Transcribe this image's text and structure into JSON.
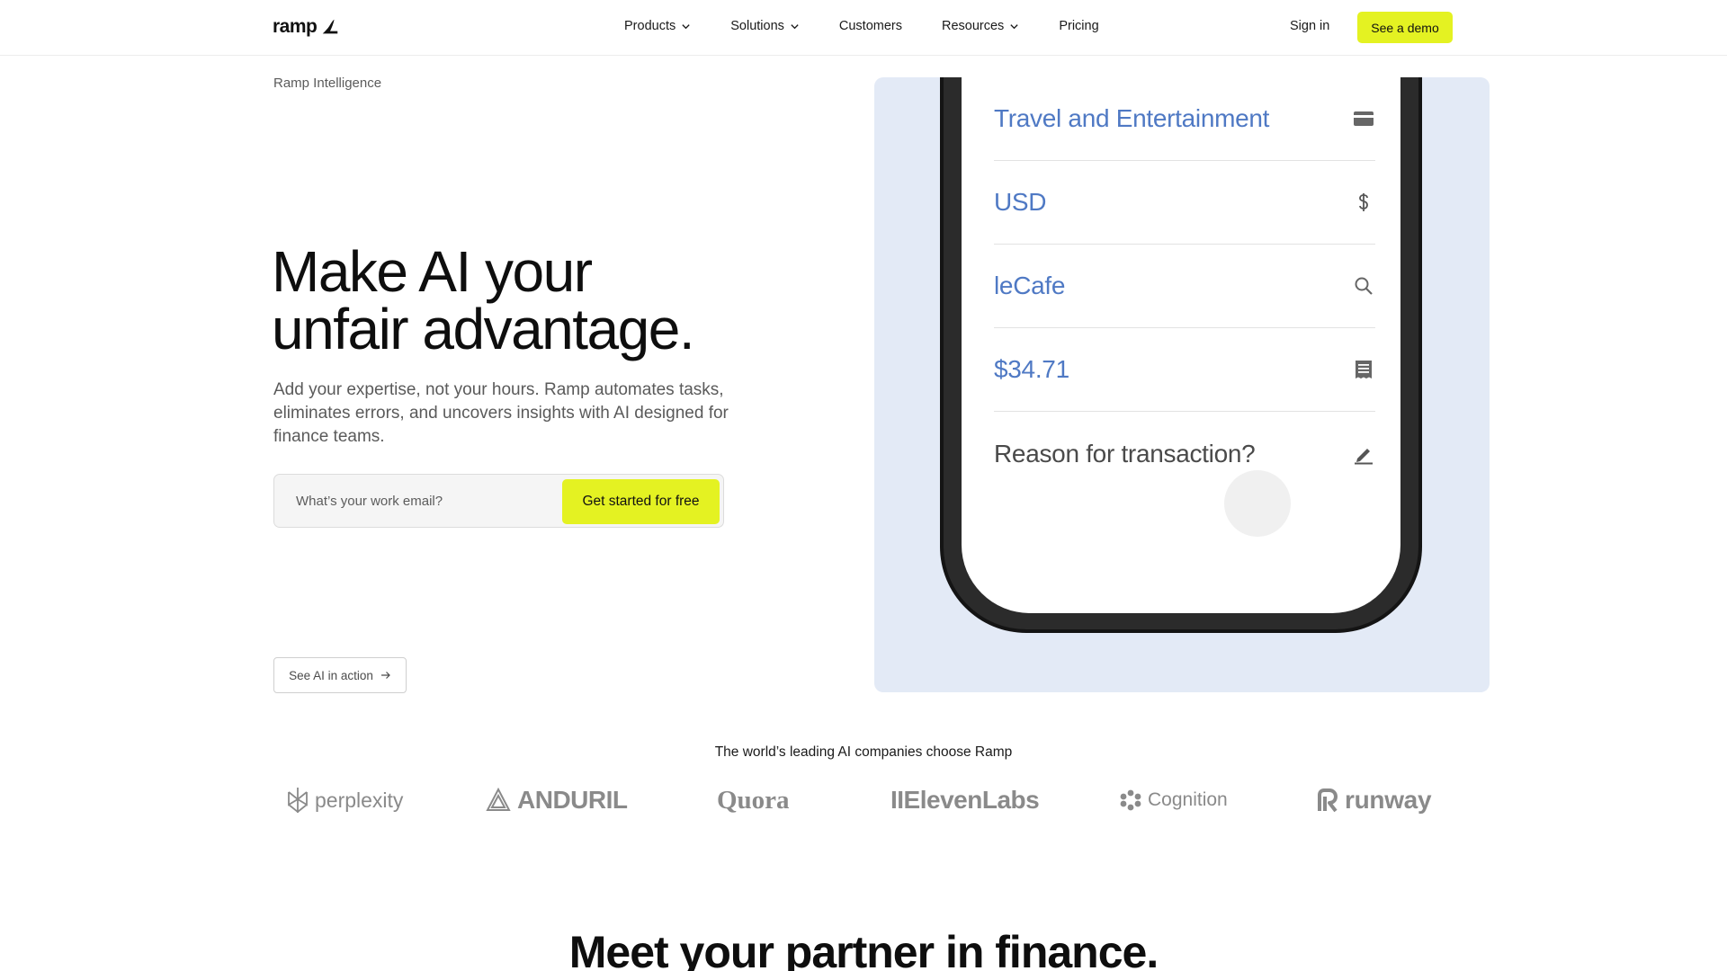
{
  "nav": {
    "logo_text": "ramp",
    "items": [
      {
        "label": "Products",
        "has_dropdown": true
      },
      {
        "label": "Solutions",
        "has_dropdown": true
      },
      {
        "label": "Customers",
        "has_dropdown": false
      },
      {
        "label": "Resources",
        "has_dropdown": true
      },
      {
        "label": "Pricing",
        "has_dropdown": false
      }
    ],
    "signin_label": "Sign in",
    "demo_label": "See a demo"
  },
  "hero": {
    "eyebrow": "Ramp Intelligence",
    "title_line1": "Make AI your",
    "title_line2": "unfair advantage.",
    "subtitle": "Add your expertise, not your hours. Ramp automates tasks, eliminates errors, and uncovers insights with AI designed for finance teams.",
    "email_placeholder": "What’s your work email?",
    "cta_label": "Get started for free",
    "secondary_label": "See AI in action"
  },
  "phone": {
    "rows": [
      {
        "text": "Travel and Entertainment",
        "icon": "credit-card-icon"
      },
      {
        "text": "USD",
        "icon": "dollar-icon"
      },
      {
        "text": "leCafe",
        "icon": "search-icon"
      },
      {
        "text": "$34.71",
        "icon": "receipt-icon"
      },
      {
        "text": "Reason for transaction?",
        "icon": "pencil-icon"
      }
    ]
  },
  "logos": {
    "title": "The world’s leading AI companies choose Ramp",
    "items": [
      "perplexity",
      "ANDURIL",
      "Quora",
      "IIElevenLabs",
      "Cognition",
      "runway"
    ]
  },
  "section": {
    "title": "Meet your partner in finance."
  },
  "colors": {
    "accent": "#e4f222",
    "phone_text_blue": "#4f79c4",
    "visual_bg": "#e3eaf6"
  }
}
